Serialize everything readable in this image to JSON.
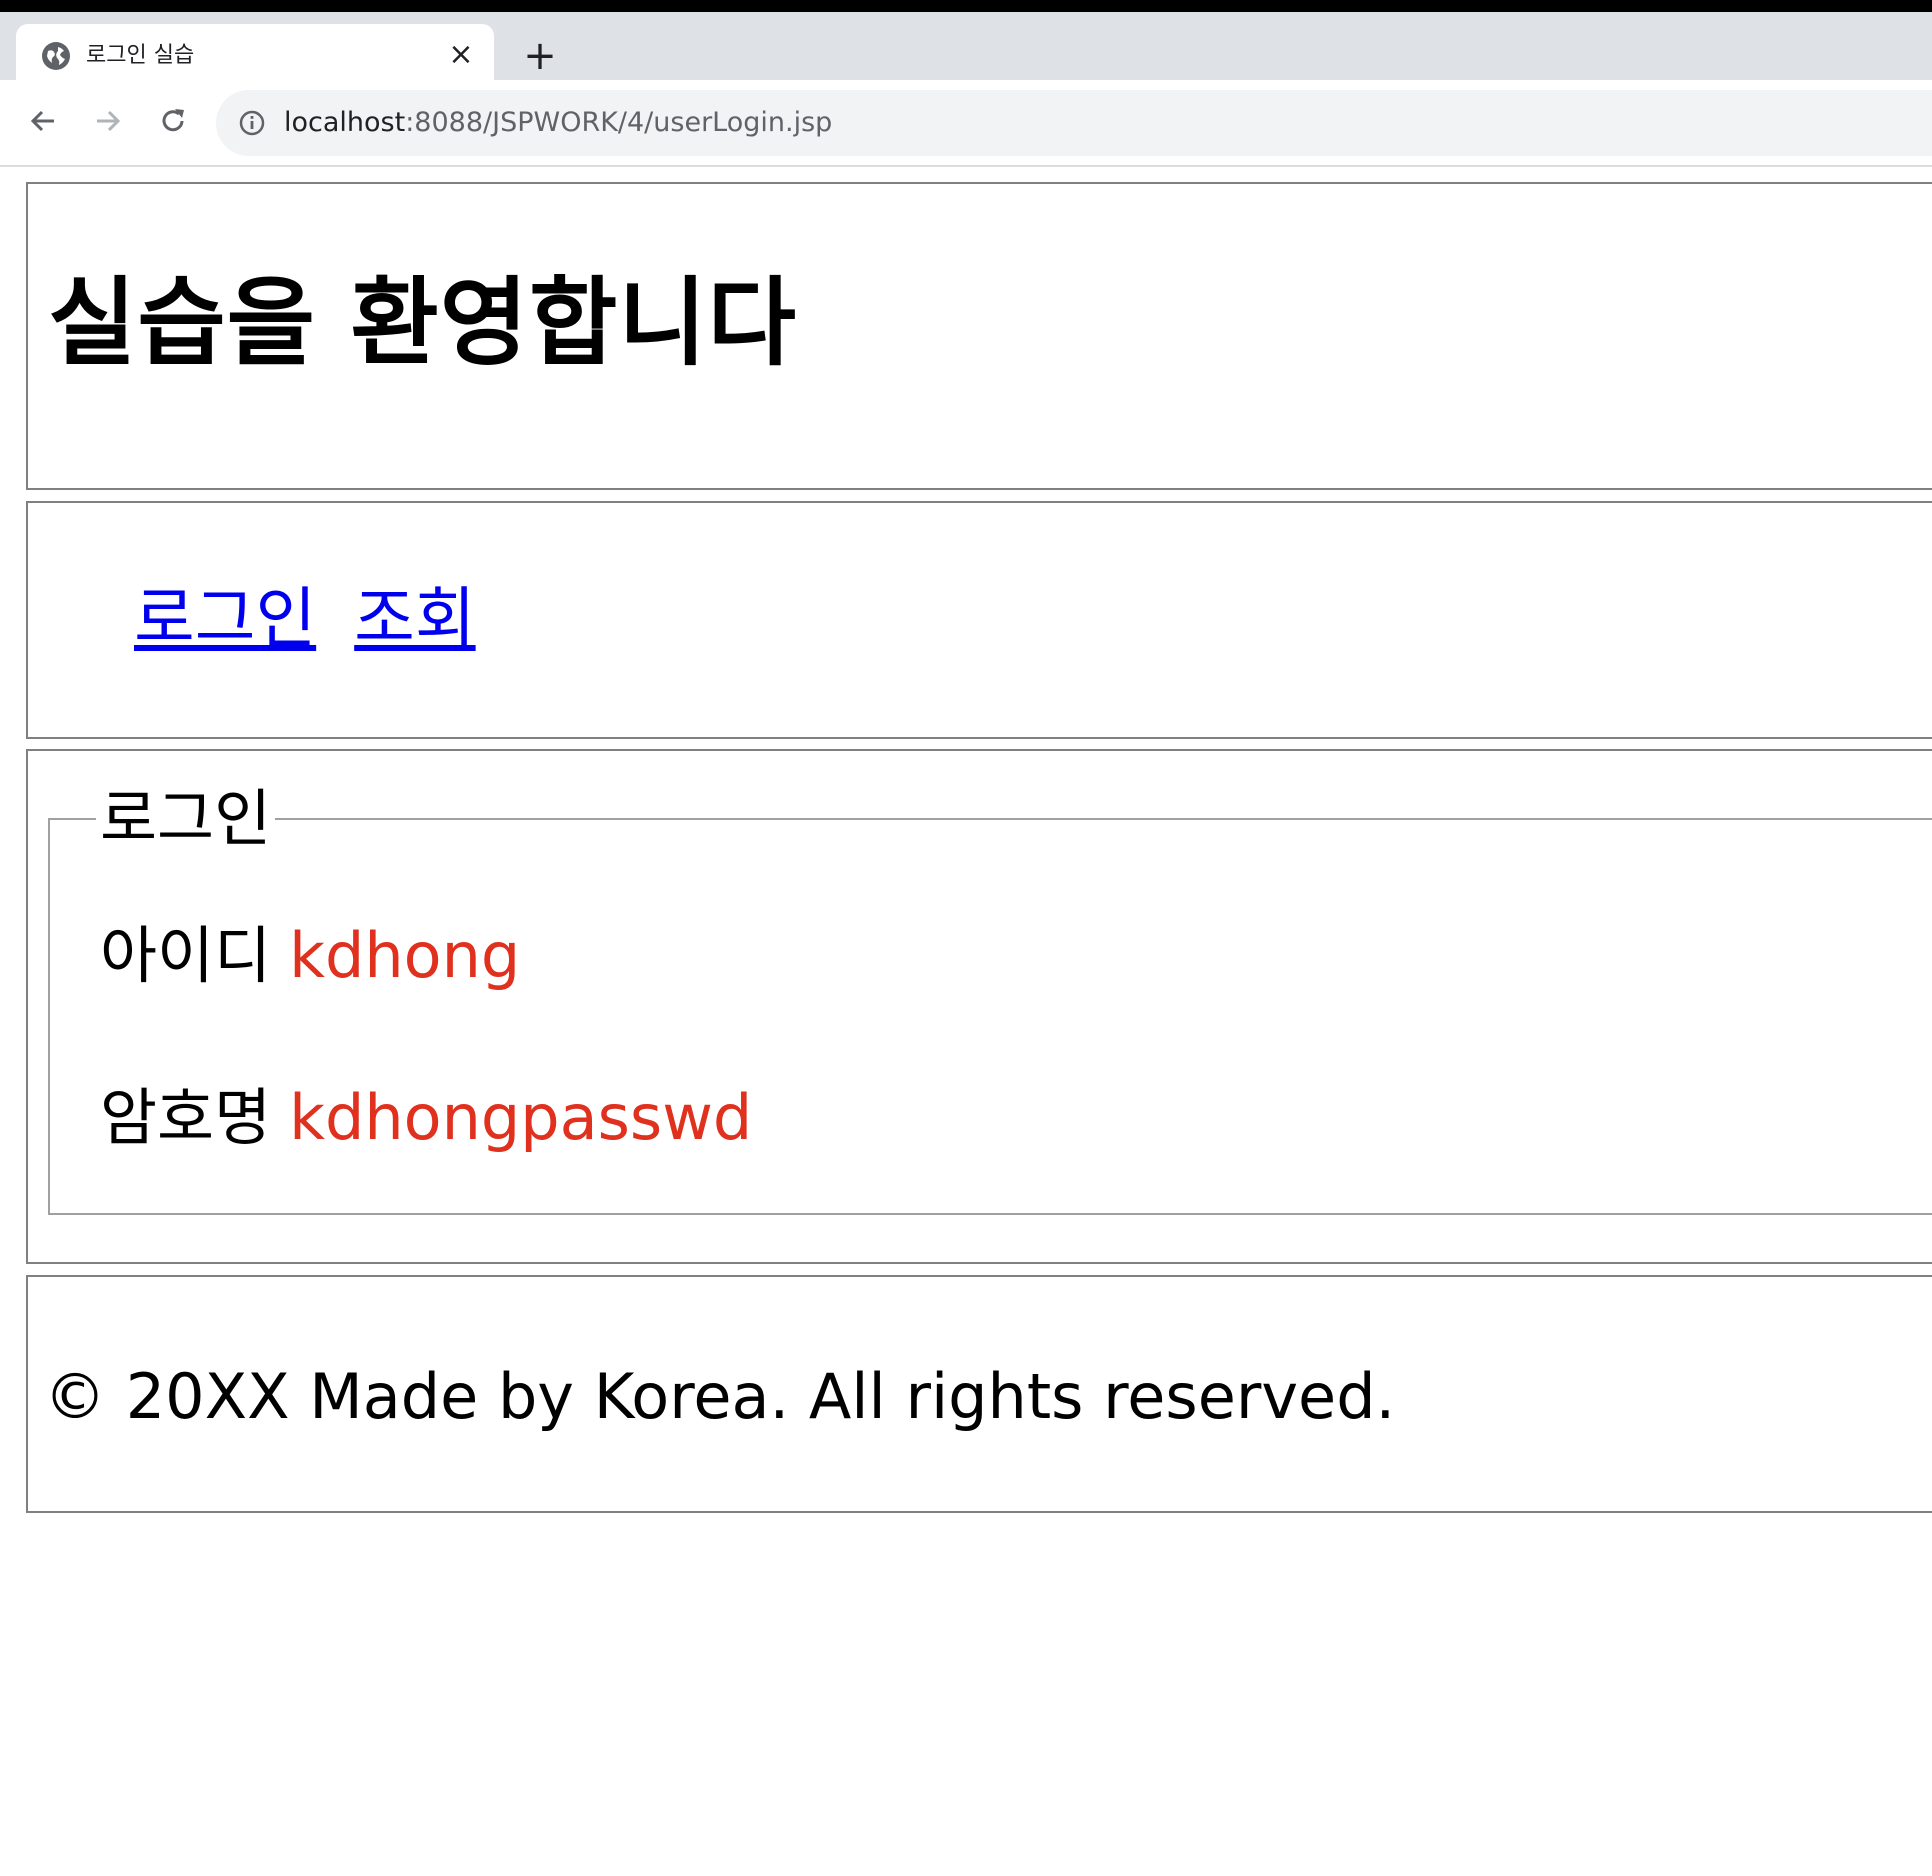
{
  "browser": {
    "tab_title": "로그인 실습",
    "tab_close": "×",
    "new_tab": "+",
    "url_host": "localhost",
    "url_rest": ":8088/JSPWORK/4/userLogin.jsp"
  },
  "header": {
    "title": "실습을 환영합니다"
  },
  "nav": {
    "links": [
      {
        "label": "로그인"
      },
      {
        "label": "조회"
      }
    ]
  },
  "login": {
    "legend": "로그인",
    "id_label": "아이디",
    "id_value": "kdhong",
    "pw_label": "암호명",
    "pw_value": "kdhongpasswd",
    "value_color": "#e0301e"
  },
  "footer": {
    "text": "© 20XX Made by Korea. All rights reserved."
  }
}
